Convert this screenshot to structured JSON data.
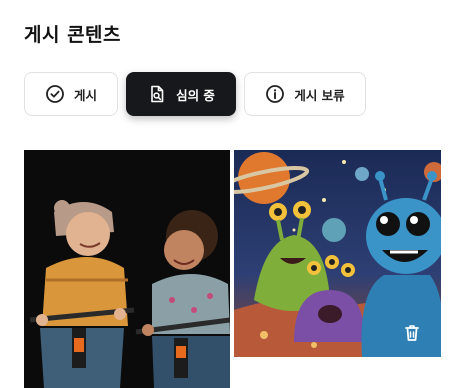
{
  "page": {
    "title": "게시 콘텐츠"
  },
  "tabs": [
    {
      "label": "게시",
      "icon": "check-circle-icon",
      "active": false
    },
    {
      "label": "심의 중",
      "icon": "document-search-icon",
      "active": true
    },
    {
      "label": "게시 보류",
      "icon": "info-circle-icon",
      "active": false
    }
  ],
  "gallery": {
    "items": [
      {
        "kind": "photo",
        "subject": "kids-on-bikes"
      },
      {
        "kind": "illustration",
        "subject": "space-aliens",
        "action_icon": "trash-icon"
      }
    ]
  },
  "colors": {
    "active_tab_bg": "#17181b",
    "tab_border": "#e2e2e2",
    "text": "#111111"
  }
}
